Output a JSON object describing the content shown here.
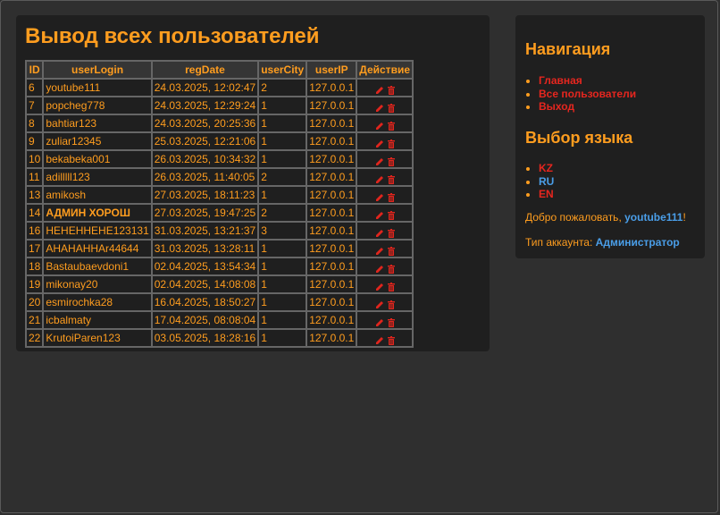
{
  "page": {
    "title": "Вывод всех пользователей"
  },
  "table": {
    "headers": [
      "ID",
      "userLogin",
      "regDate",
      "userCity",
      "userIP",
      "Действие"
    ],
    "rows": [
      {
        "id": "6",
        "login": "youtube111",
        "regDate": "24.03.2025, 12:02:47",
        "city": "2",
        "ip": "127.0.0.1",
        "bold": false
      },
      {
        "id": "7",
        "login": "popcheg778",
        "regDate": "24.03.2025, 12:29:24",
        "city": "1",
        "ip": "127.0.0.1",
        "bold": false
      },
      {
        "id": "8",
        "login": "bahtiar123",
        "regDate": "24.03.2025, 20:25:36",
        "city": "1",
        "ip": "127.0.0.1",
        "bold": false
      },
      {
        "id": "9",
        "login": "zuliar12345",
        "regDate": "25.03.2025, 12:21:06",
        "city": "1",
        "ip": "127.0.0.1",
        "bold": false
      },
      {
        "id": "10",
        "login": "bekabeka001",
        "regDate": "26.03.2025, 10:34:32",
        "city": "1",
        "ip": "127.0.0.1",
        "bold": false
      },
      {
        "id": "11",
        "login": "adilllll123",
        "regDate": "26.03.2025, 11:40:05",
        "city": "2",
        "ip": "127.0.0.1",
        "bold": false
      },
      {
        "id": "13",
        "login": "amikosh",
        "regDate": "27.03.2025, 18:11:23",
        "city": "1",
        "ip": "127.0.0.1",
        "bold": false
      },
      {
        "id": "14",
        "login": "АДМИН ХОРОШ",
        "regDate": "27.03.2025, 19:47:25",
        "city": "2",
        "ip": "127.0.0.1",
        "bold": true
      },
      {
        "id": "16",
        "login": "НЕНЕННЕНЕ123131",
        "regDate": "31.03.2025, 13:21:37",
        "city": "3",
        "ip": "127.0.0.1",
        "bold": false
      },
      {
        "id": "17",
        "login": "АНАНАННАr44644",
        "regDate": "31.03.2025, 13:28:11",
        "city": "1",
        "ip": "127.0.0.1",
        "bold": false
      },
      {
        "id": "18",
        "login": "Bastaubaevdoni1",
        "regDate": "02.04.2025, 13:54:34",
        "city": "1",
        "ip": "127.0.0.1",
        "bold": false
      },
      {
        "id": "19",
        "login": "mikonay20",
        "regDate": "02.04.2025, 14:08:08",
        "city": "1",
        "ip": "127.0.0.1",
        "bold": false
      },
      {
        "id": "20",
        "login": "esmirochka28",
        "regDate": "16.04.2025, 18:50:27",
        "city": "1",
        "ip": "127.0.0.1",
        "bold": false
      },
      {
        "id": "21",
        "login": "icbalmaty",
        "regDate": "17.04.2025, 08:08:04",
        "city": "1",
        "ip": "127.0.0.1",
        "bold": false
      },
      {
        "id": "22",
        "login": "KrutoiParen123",
        "regDate": "03.05.2025, 18:28:16",
        "city": "1",
        "ip": "127.0.0.1",
        "bold": false
      }
    ],
    "action_icons": [
      "pencil-icon",
      "trash-icon"
    ]
  },
  "navigation": {
    "title": "Навигация",
    "items": [
      "Главная",
      "Все пользователи",
      "Выход"
    ]
  },
  "language": {
    "title": "Выбор языка",
    "items": [
      "KZ",
      "RU",
      "EN"
    ],
    "current": "RU"
  },
  "welcome": {
    "prefix": "Добро пожаловать, ",
    "username": "youtube111",
    "suffix": "!"
  },
  "account": {
    "label": "Тип аккаунта: ",
    "type": "Администратор"
  },
  "colors": {
    "accent": "#ff9d1f",
    "link": "#e6261f",
    "highlight": "#4a9ee8",
    "panel": "#1f1f1f",
    "background": "#2f2f2f"
  }
}
